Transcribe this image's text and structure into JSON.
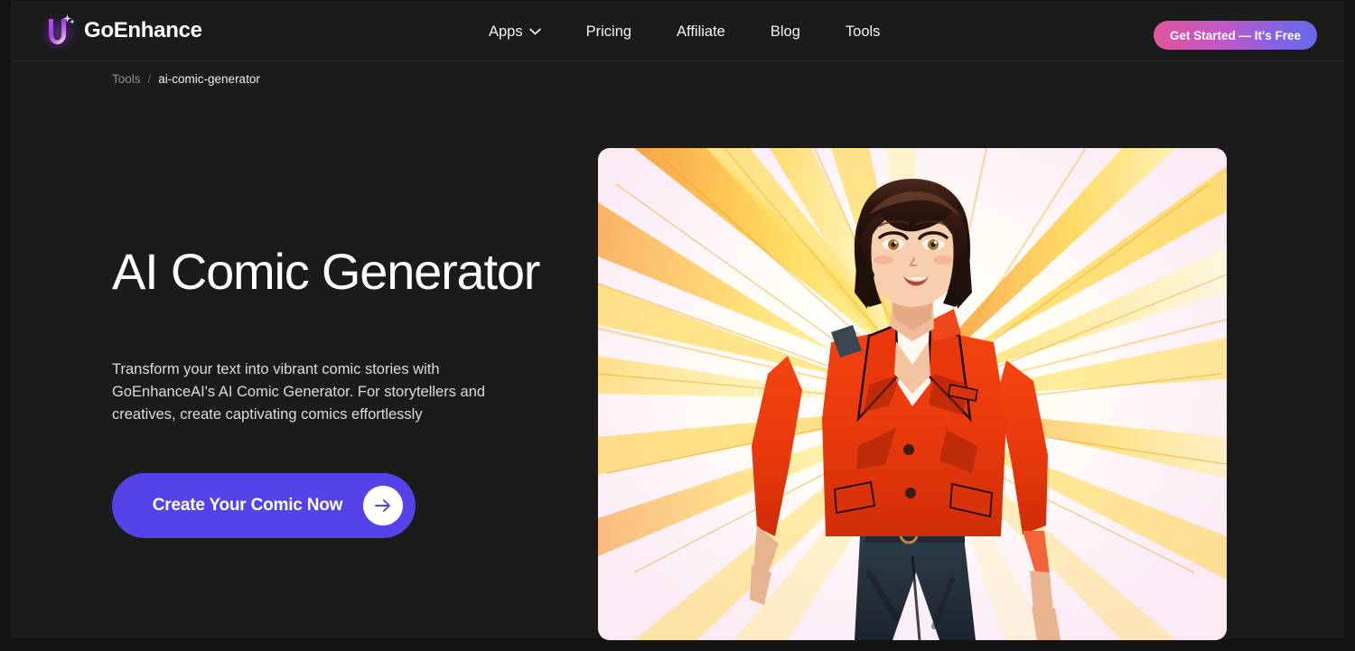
{
  "brand": {
    "name": "GoEnhance",
    "logo_icon": "goenhance-u-logo-icon"
  },
  "nav": {
    "items": [
      {
        "label": "Apps",
        "icon": "chevron-down-icon",
        "has_dropdown": true
      },
      {
        "label": "Pricing",
        "has_dropdown": false
      },
      {
        "label": "Affiliate",
        "has_dropdown": false
      },
      {
        "label": "Blog",
        "has_dropdown": false
      },
      {
        "label": "Tools",
        "has_dropdown": false
      }
    ],
    "cta_label": "Get Started — It's Free"
  },
  "breadcrumb": {
    "parent": "Tools",
    "separator": "/",
    "current": "ai-comic-generator"
  },
  "hero": {
    "title": "AI Comic Generator",
    "description": "Transform your text into vibrant comic stories with GoEnhanceAI's AI Comic Generator. For storytellers and creatives, create captivating comics effortlessly",
    "cta_label": "Create Your Comic Now",
    "cta_icon": "arrow-right-icon",
    "image_alt": "Anime-style woman in red blazer with radiating yellow speed lines"
  },
  "colors": {
    "page_background": "#1b1b1b",
    "frame": "#131313",
    "accent_purple": "#5343e8",
    "gradient_start": "#e0549c",
    "gradient_end": "#6669ea",
    "text_primary": "#ffffff",
    "text_muted": "#909090"
  }
}
